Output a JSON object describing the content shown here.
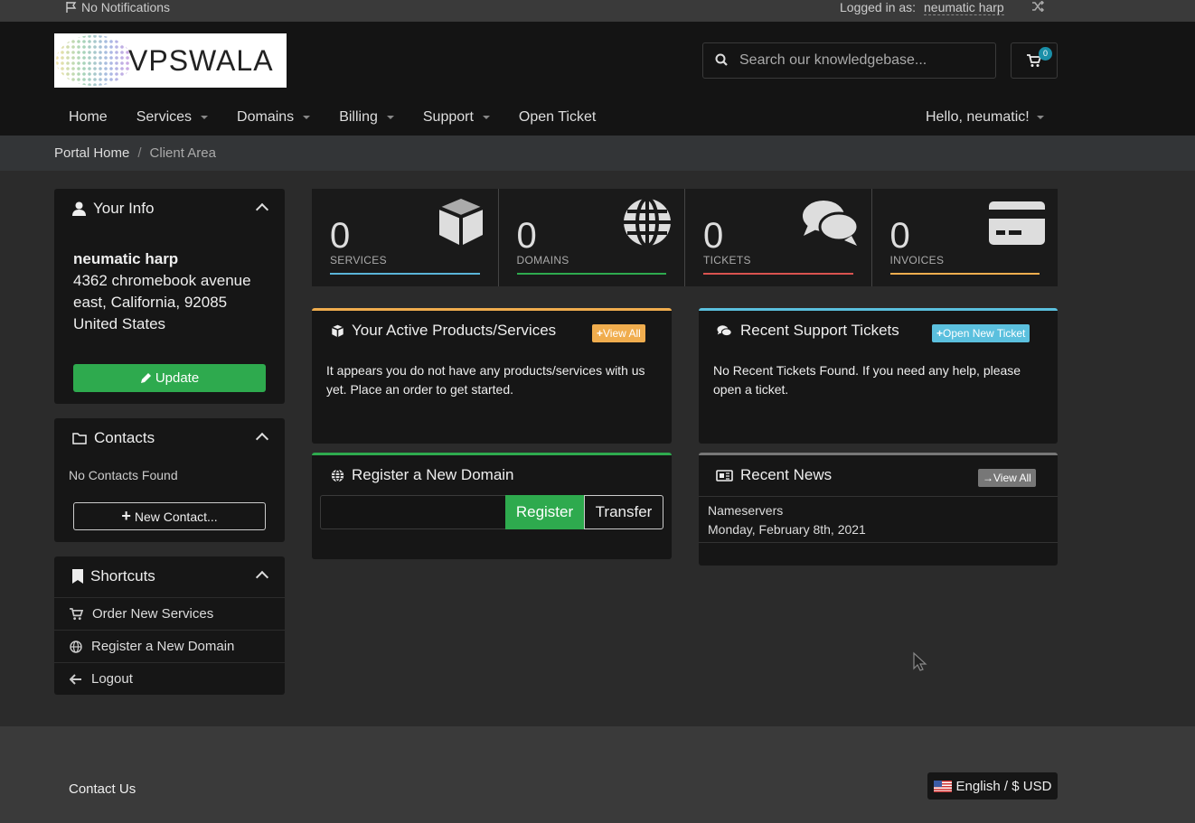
{
  "topbar": {
    "notifications": "No Notifications",
    "logged_in_as": "Logged in as:",
    "username": "neumatic harp"
  },
  "header": {
    "logo_text": "VPSWALA",
    "search_placeholder": "Search our knowledgebase...",
    "cart_count": "0"
  },
  "nav": {
    "items": [
      "Home",
      "Services",
      "Domains",
      "Billing",
      "Support",
      "Open Ticket"
    ],
    "greeting": "Hello, neumatic!"
  },
  "breadcrumb": {
    "home": "Portal Home",
    "separator": "/",
    "current": "Client Area"
  },
  "your_info": {
    "title": "Your Info",
    "name": "neumatic harp",
    "address1": "4362 chromebook avenue",
    "address2": "east, California, 92085",
    "country": "United States",
    "update_label": "Update"
  },
  "contacts": {
    "title": "Contacts",
    "empty": "No Contacts Found",
    "new_label": "New Contact..."
  },
  "shortcuts": {
    "title": "Shortcuts",
    "items": [
      "Order New Services",
      "Register a New Domain",
      "Logout"
    ]
  },
  "stats": [
    {
      "count": "0",
      "label": "SERVICES",
      "color": "#5ab4d8",
      "icon": "cube-icon"
    },
    {
      "count": "0",
      "label": "DOMAINS",
      "color": "#2eaa4e",
      "icon": "globe-icon"
    },
    {
      "count": "0",
      "label": "TICKETS",
      "color": "#d9534f",
      "icon": "comments-icon"
    },
    {
      "count": "0",
      "label": "INVOICES",
      "color": "#f0ad4e",
      "icon": "credit-card-icon"
    }
  ],
  "products": {
    "title": "Your Active Products/Services",
    "view_all": "View All",
    "text": "It appears you do not have any products/services with us yet.",
    "link": "Place an order to get started."
  },
  "tickets": {
    "title": "Recent Support Tickets",
    "open_new": "Open New Ticket",
    "text": "No Recent Tickets Found. If you need any help, please",
    "link": "open a ticket."
  },
  "domain": {
    "title": "Register a New Domain",
    "register": "Register",
    "transfer": "Transfer"
  },
  "news": {
    "title": "Recent News",
    "view_all": "View All",
    "item_title": "Nameservers",
    "item_date": "Monday, February 8th, 2021"
  },
  "footer": {
    "contact": "Contact Us",
    "language": "English / $ USD"
  },
  "colors": {
    "green": "#2eaa4e",
    "orange": "#f0ad4e",
    "blue": "#5bc0de",
    "gray": "#777777"
  }
}
